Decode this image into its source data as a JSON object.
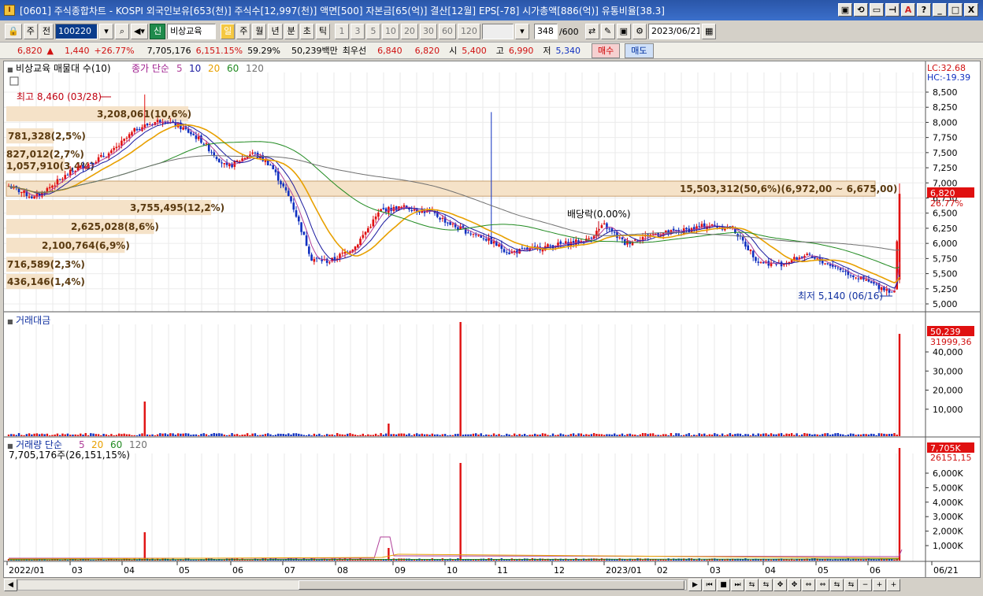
{
  "window": {
    "title": "[0601] 주식종합차트 - KOSPI 외국인보유[653(천)] 주식수[12,997(천)] 액면[500] 자본금[65(억)] 결산[12월] EPS[-78] 시가총액[886(억)] 유통비율[38.3]",
    "icon": "I",
    "controls": [
      "▣",
      "⟲",
      "▭",
      "⊣",
      "A",
      "?",
      "_",
      "□",
      "X"
    ]
  },
  "toolbar": {
    "market": "주",
    "prev": "전",
    "code": "100220",
    "search_icon": "search-icon",
    "sound_icon": "speaker-icon",
    "sin_badge": "신",
    "stock_name": "비상교육",
    "periods": [
      "일",
      "주",
      "월",
      "년",
      "분",
      "초",
      "틱"
    ],
    "active_period": "일",
    "intervals": [
      "1",
      "3",
      "5",
      "10",
      "20",
      "30",
      "60",
      "120"
    ],
    "count": "348",
    "count_total": "/600",
    "date": "2023/06/21"
  },
  "quote": {
    "price": "6,820",
    "arrow": "▲",
    "change": "1,440",
    "change_pct": "+26.77%",
    "volume": "7,705,176",
    "vol_ratio": "6,151.15%",
    "turnover": "59.29%",
    "amount": "50,239백만",
    "best_label": "최우선",
    "ask": "6,840",
    "bid": "6,820",
    "open_label": "시",
    "open": "5,400",
    "high_label": "고",
    "high": "6,990",
    "low_label": "저",
    "low": "5,340",
    "buy": "매수",
    "sell": "매도"
  },
  "price_panel": {
    "legend_name": "비상교육 매물대 수(10)",
    "legend_ma": "종가 단순",
    "ma_periods": [
      "5",
      "10",
      "20",
      "60",
      "120"
    ],
    "ma_colors": [
      "#b0409a",
      "#1a1aa0",
      "#e8a000",
      "#208a20",
      "#707070"
    ],
    "lc": "LC:32.68",
    "hc": "HC:-19.39",
    "max_label": "최고 8,460 (03/28)",
    "min_label": "최저 5,140 (06/16)",
    "dividend_label": "배당락(0.00%)",
    "last_price": "6,820",
    "last_pct": "26.77%",
    "y_ticks": [
      "8,500",
      "8,250",
      "8,000",
      "7,750",
      "7,500",
      "7,250",
      "7,000",
      "6,750",
      "6,500",
      "6,250",
      "6,000",
      "5,750",
      "5,500",
      "5,250",
      "5,000"
    ],
    "volume_profile": [
      {
        "label": "3,208,061(10,6%)",
        "share": 10.6
      },
      {
        "label": "781,328(2,5%)",
        "share": 2.5
      },
      {
        "label": "827,012(2,7%)",
        "share": 2.7
      },
      {
        "label": "1,057,910(3,4%)",
        "share": 3.4
      },
      {
        "label": "15,503,312(50,6%)(6,972,00 ~ 6,675,00)",
        "share": 50.6
      },
      {
        "label": "3,755,495(12,2%)",
        "share": 12.2
      },
      {
        "label": "2,625,028(8,6%)",
        "share": 8.6
      },
      {
        "label": "2,100,764(6,9%)",
        "share": 6.9
      },
      {
        "label": "716,589(2,3%)",
        "share": 2.3
      },
      {
        "label": "436,146(1,4%)",
        "share": 1.4
      }
    ]
  },
  "amount_panel": {
    "legend": "거래대금",
    "last": "50,239",
    "avg": "31999,36",
    "y_ticks": [
      "40,000",
      "30,000",
      "20,000",
      "10,000"
    ]
  },
  "volume_panel": {
    "legend": "거래량 단순",
    "ma_periods": [
      "5",
      "20",
      "60",
      "120"
    ],
    "sub": "7,705,176주(26,151,15%)",
    "last": "7,705K",
    "avg": "26151,15",
    "y_ticks": [
      "6,000K",
      "5,000K",
      "4,000K",
      "3,000K",
      "2,000K",
      "1,000K"
    ]
  },
  "x_axis": [
    "2022/01",
    "03",
    "04",
    "05",
    "06",
    "07",
    "08",
    "09",
    "10",
    "11",
    "12",
    "2023/01",
    "02",
    "03",
    "04",
    "05",
    "06",
    "06/21"
  ],
  "colors": {
    "up": "#e01010",
    "down": "#1030c0",
    "profile": "#f5e2c8",
    "profile_hi": "#f3dcc0"
  },
  "scrollbar": {
    "buttons": [
      "◀",
      "▶",
      "⏮",
      "■",
      "⏭",
      "⇆",
      "⇆",
      "✥",
      "✥",
      "⇔",
      "⇔",
      "⇆",
      "⇆",
      "−",
      "+",
      "+"
    ]
  }
}
